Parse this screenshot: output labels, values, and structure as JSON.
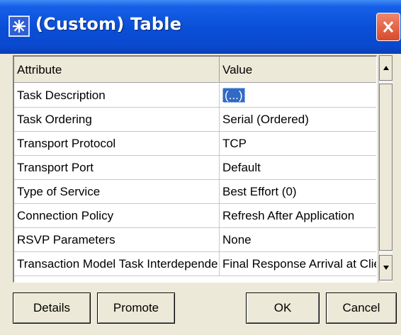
{
  "window": {
    "title": "(Custom) Table",
    "icon": "asterisk-app-icon",
    "close_icon": "close-x-icon"
  },
  "table": {
    "columns": [
      "Attribute",
      "Value"
    ],
    "rows": [
      {
        "attribute": "Task Description",
        "value": "(...)",
        "selected": true
      },
      {
        "attribute": "Task Ordering",
        "value": "Serial (Ordered)"
      },
      {
        "attribute": "Transport Protocol",
        "value": "TCP"
      },
      {
        "attribute": "Transport Port",
        "value": "Default"
      },
      {
        "attribute": "Type of Service",
        "value": "Best Effort (0)"
      },
      {
        "attribute": "Connection Policy",
        "value": "Refresh After Application"
      },
      {
        "attribute": "RSVP Parameters",
        "value": "None"
      },
      {
        "attribute": "Transaction Model Task Interdepende...",
        "value": "Final Response Arrival at Client"
      }
    ]
  },
  "scrollbar": {
    "up_icon": "arrow-up-icon",
    "down_icon": "arrow-down-icon"
  },
  "buttons": {
    "details": "Details",
    "promote": "Promote",
    "ok": "OK",
    "cancel": "Cancel"
  },
  "colors": {
    "titlebar": "#0a4fd8",
    "selection": "#316ac5",
    "close": "#d74a2c",
    "dialog_bg": "#ece9d8"
  }
}
